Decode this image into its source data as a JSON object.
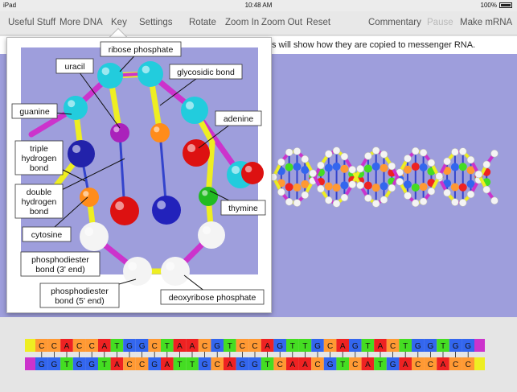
{
  "status": {
    "device": "iPad",
    "time": "10:48 AM",
    "battery": "100%"
  },
  "toolbar": {
    "useful": "Useful Stuff",
    "more": "More DNA",
    "key": "Key",
    "settings": "Settings",
    "rotate": "Rotate",
    "zoom_in": "Zoom In",
    "zoom_out": "Zoom Out",
    "reset": "Reset",
    "commentary": "Commentary",
    "pause": "Pause",
    "make_mrna": "Make mRNA"
  },
  "message": "s will show how they are copied to messenger RNA.",
  "key_labels": {
    "ribose": "ribose phosphate",
    "uracil": "uracil",
    "glycosidic": "glycosidic bond",
    "guanine": "guanine",
    "adenine": "adenine",
    "triple_1": "triple",
    "triple_2": "hydrogen",
    "triple_3": "bond",
    "double_1": "double",
    "double_2": "hydrogen",
    "double_3": "bond",
    "thymine": "thymine",
    "cytosine": "cytosine",
    "pd3_1": "phosphodiester",
    "pd3_2": "bond (3' end)",
    "pd5_1": "phosphodiester",
    "pd5_2": "bond (5' end)",
    "deoxy": "deoxyribose phosphate"
  },
  "sequence": {
    "top": [
      "C",
      "C",
      "A",
      "C",
      "C",
      "A",
      "T",
      "G",
      "G",
      "C",
      "T",
      "A",
      "A",
      "C",
      "G",
      "T",
      "C",
      "C",
      "A",
      "G",
      "T",
      "T",
      "G",
      "C",
      "A",
      "G",
      "T",
      "A",
      "C",
      "T",
      "G",
      "G",
      "T",
      "G",
      "G"
    ],
    "bottom": [
      "G",
      "G",
      "T",
      "G",
      "G",
      "T",
      "A",
      "C",
      "C",
      "G",
      "A",
      "T",
      "T",
      "G",
      "C",
      "A",
      "G",
      "G",
      "T",
      "C",
      "A",
      "A",
      "C",
      "G",
      "T",
      "C",
      "A",
      "T",
      "G",
      "A",
      "C",
      "C",
      "A",
      "C",
      "C"
    ]
  },
  "colors": {
    "A": "#ee2222",
    "T": "#44dd22",
    "G": "#3366ee",
    "C": "#ff9933",
    "backbone": "#cc33cc",
    "end": "#eeee22",
    "stage": "#9e9edc"
  }
}
